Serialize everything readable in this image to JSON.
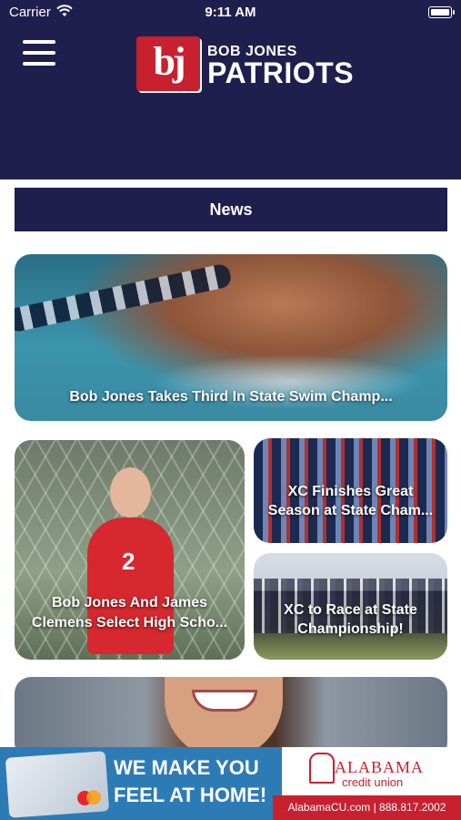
{
  "status_bar": {
    "carrier": "Carrier",
    "time": "9:11 AM"
  },
  "header": {
    "logo_mark": "bj",
    "logo_subtitle": "BOB JONES",
    "logo_title": "PATRIOTS"
  },
  "section_button": "News",
  "news": [
    {
      "title": "Bob Jones Takes Third In State Swim Champ..."
    },
    {
      "title": "Bob Jones And James Clemens Select High Scho..."
    },
    {
      "title": "XC Finishes Great Season at State Cham..."
    },
    {
      "title": "XC to Race at State Championship!"
    }
  ],
  "player_number": "2",
  "ad": {
    "tagline_line1": "WE MAKE YOU",
    "tagline_line2": "FEEL AT HOME!",
    "brand_name": "ALABAMA",
    "brand_sub": "credit union",
    "contact": "AlabamaCU.com | 888.817.2002"
  },
  "colors": {
    "header_bg": "#1e1f4d",
    "accent_red": "#c8202f",
    "ad_blue": "#2d7bb5"
  },
  "icons": [
    "wifi-icon",
    "battery-icon",
    "hamburger-menu-icon"
  ]
}
